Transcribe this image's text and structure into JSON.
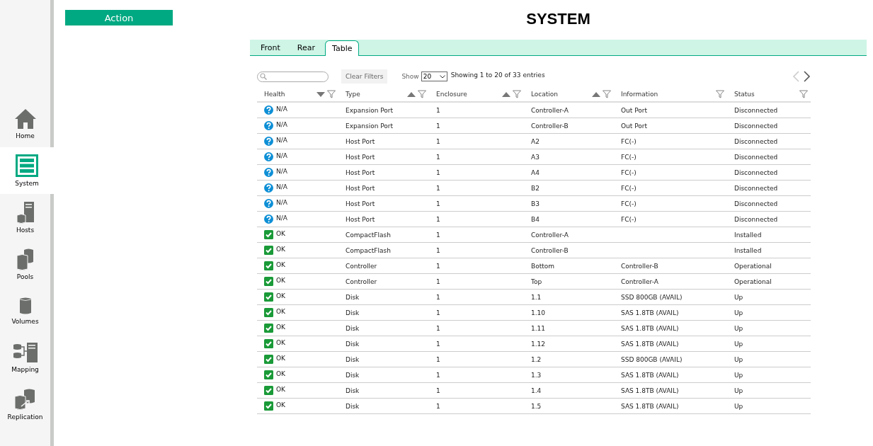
{
  "sidebar": {
    "items": [
      {
        "label": "Home",
        "kind": "home",
        "selected": false
      },
      {
        "label": "System",
        "kind": "system",
        "selected": true
      },
      {
        "label": "Hosts",
        "kind": "hosts",
        "selected": false
      },
      {
        "label": "Pools",
        "kind": "pools",
        "selected": false
      },
      {
        "label": "Volumes",
        "kind": "volumes",
        "selected": false
      },
      {
        "label": "Mapping",
        "kind": "mapping",
        "selected": false
      },
      {
        "label": "Replication",
        "kind": "replication",
        "selected": false
      }
    ]
  },
  "action_button": "Action",
  "title": "SYSTEM",
  "tabs": [
    {
      "label": "Front",
      "selected": false
    },
    {
      "label": "Rear",
      "selected": false
    },
    {
      "label": "Table",
      "selected": true
    }
  ],
  "toolbar": {
    "clear_filters": "Clear Filters",
    "show_label": "Show",
    "page_size": "20",
    "summary": "Showing 1 to 20 of 33 entries",
    "prev_disabled": true,
    "next_disabled": false
  },
  "table": {
    "columns": [
      {
        "label": "Health",
        "kind": "sort_desc"
      },
      {
        "label": "Type",
        "kind": "sort_asc"
      },
      {
        "label": "Enclosure",
        "kind": "sort_asc"
      },
      {
        "label": "Location",
        "kind": "sort_asc"
      },
      {
        "label": "Information",
        "kind": "plain"
      },
      {
        "label": "Status",
        "kind": "plain"
      }
    ],
    "rows": [
      {
        "kind": "unknown",
        "cells": [
          "N/A",
          "Expansion Port",
          "1",
          "Controller-A",
          "Out Port",
          "Disconnected"
        ]
      },
      {
        "kind": "unknown",
        "cells": [
          "N/A",
          "Expansion Port",
          "1",
          "Controller-B",
          "Out Port",
          "Disconnected"
        ]
      },
      {
        "kind": "unknown",
        "cells": [
          "N/A",
          "Host Port",
          "1",
          "A2",
          "FC(-)",
          "Disconnected"
        ]
      },
      {
        "kind": "unknown",
        "cells": [
          "N/A",
          "Host Port",
          "1",
          "A3",
          "FC(-)",
          "Disconnected"
        ]
      },
      {
        "kind": "unknown",
        "cells": [
          "N/A",
          "Host Port",
          "1",
          "A4",
          "FC(-)",
          "Disconnected"
        ]
      },
      {
        "kind": "unknown",
        "cells": [
          "N/A",
          "Host Port",
          "1",
          "B2",
          "FC(-)",
          "Disconnected"
        ]
      },
      {
        "kind": "unknown",
        "cells": [
          "N/A",
          "Host Port",
          "1",
          "B3",
          "FC(-)",
          "Disconnected"
        ]
      },
      {
        "kind": "unknown",
        "cells": [
          "N/A",
          "Host Port",
          "1",
          "B4",
          "FC(-)",
          "Disconnected"
        ]
      },
      {
        "kind": "ok",
        "cells": [
          "OK",
          "CompactFlash",
          "1",
          "Controller-A",
          "",
          "Installed"
        ]
      },
      {
        "kind": "ok",
        "cells": [
          "OK",
          "CompactFlash",
          "1",
          "Controller-B",
          "",
          "Installed"
        ]
      },
      {
        "kind": "ok",
        "cells": [
          "OK",
          "Controller",
          "1",
          "Bottom",
          "Controller-B",
          "Operational"
        ]
      },
      {
        "kind": "ok",
        "cells": [
          "OK",
          "Controller",
          "1",
          "Top",
          "Controller-A",
          "Operational"
        ]
      },
      {
        "kind": "ok",
        "cells": [
          "OK",
          "Disk",
          "1",
          "1.1",
          "SSD 800GB (AVAIL)",
          "Up"
        ]
      },
      {
        "kind": "ok",
        "cells": [
          "OK",
          "Disk",
          "1",
          "1.10",
          "SAS 1.8TB (AVAIL)",
          "Up"
        ]
      },
      {
        "kind": "ok",
        "cells": [
          "OK",
          "Disk",
          "1",
          "1.11",
          "SAS 1.8TB (AVAIL)",
          "Up"
        ]
      },
      {
        "kind": "ok",
        "cells": [
          "OK",
          "Disk",
          "1",
          "1.12",
          "SAS 1.8TB (AVAIL)",
          "Up"
        ]
      },
      {
        "kind": "ok",
        "cells": [
          "OK",
          "Disk",
          "1",
          "1.2",
          "SSD 800GB (AVAIL)",
          "Up"
        ]
      },
      {
        "kind": "ok",
        "cells": [
          "OK",
          "Disk",
          "1",
          "1.3",
          "SAS 1.8TB (AVAIL)",
          "Up"
        ]
      },
      {
        "kind": "ok",
        "cells": [
          "OK",
          "Disk",
          "1",
          "1.4",
          "SAS 1.8TB (AVAIL)",
          "Up"
        ]
      },
      {
        "kind": "ok",
        "cells": [
          "OK",
          "Disk",
          "1",
          "1.5",
          "SAS 1.8TB (AVAIL)",
          "Up"
        ]
      }
    ]
  }
}
